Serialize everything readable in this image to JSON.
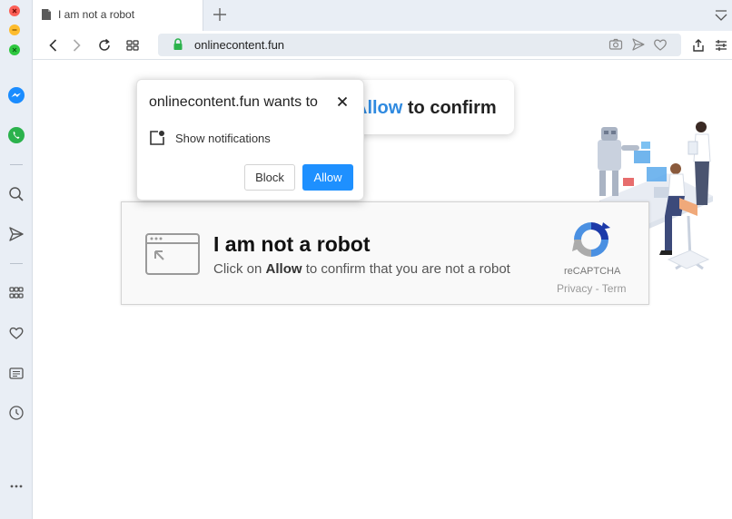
{
  "browser": {
    "tab": {
      "title": "I am not a robot"
    },
    "address_bar": {
      "url": "onlinecontent.fun"
    }
  },
  "banner": {
    "allow_word": "Allow",
    "rest": " to confirm"
  },
  "captcha": {
    "title": "I am not a robot",
    "subtitle_pre": "Click on ",
    "subtitle_bold": "Allow",
    "subtitle_post": " to confirm that you are not a robot",
    "brand": "reCAPTCHA",
    "links": "Privacy - Term"
  },
  "permission_popup": {
    "title": "onlinecontent.fun wants to",
    "item": "Show notifications",
    "block_label": "Block",
    "allow_label": "Allow"
  },
  "colors": {
    "accent_blue": "#1e90ff",
    "sidebar_bg": "#e9eef5",
    "lock_green": "#2bb24c"
  }
}
